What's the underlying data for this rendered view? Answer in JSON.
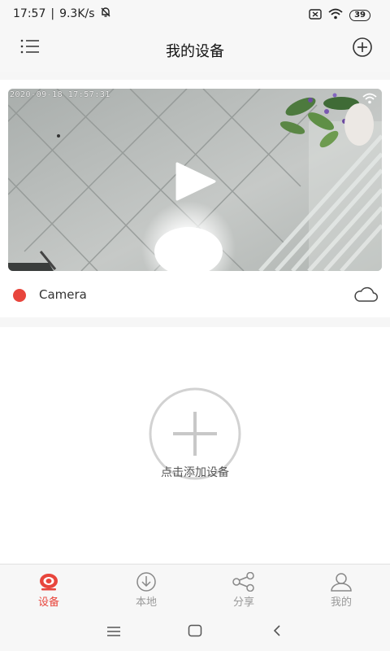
{
  "status_bar": {
    "time": "17:57",
    "speed": "9.3K/s",
    "battery": "39"
  },
  "header": {
    "title": "我的设备"
  },
  "device": {
    "timestamp": "2020-09-18 17:57:31",
    "name": "Camera"
  },
  "add_device": {
    "label": "点击添加设备"
  },
  "bottom_nav": {
    "items": [
      {
        "label": "设备",
        "active": true
      },
      {
        "label": "本地"
      },
      {
        "label": "分享"
      },
      {
        "label": "我的"
      }
    ]
  },
  "colors": {
    "accent": "#e8453c",
    "inactive": "#999999"
  }
}
